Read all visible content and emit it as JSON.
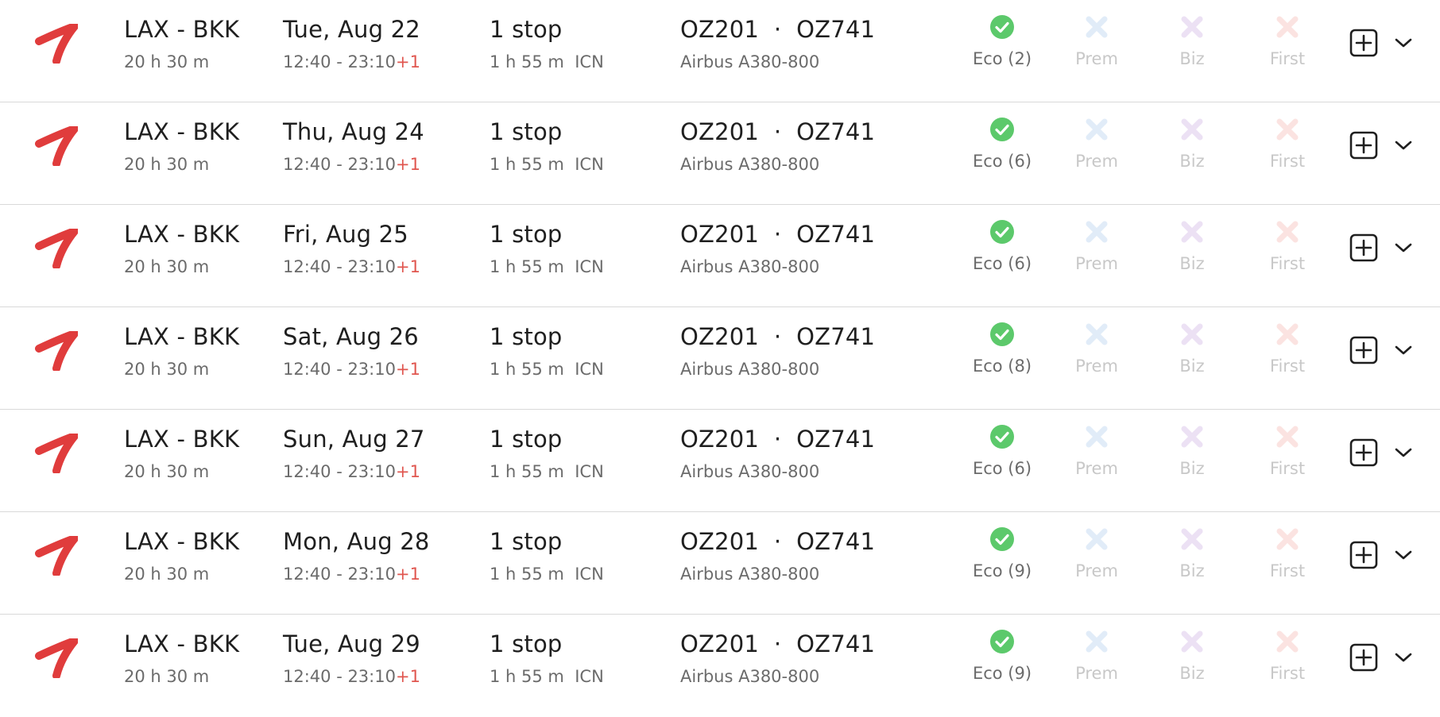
{
  "colors": {
    "logo": "#e03c3c",
    "available": "#5cc96b",
    "prem_unavailable": "#e1ecf8",
    "biz_unavailable": "#ece1f4",
    "first_unavailable": "#fbe3e1",
    "plus_one": "#e0564f"
  },
  "icons": {
    "airline_logo": "airline-logo-icon",
    "available": "check-circle-icon",
    "unavailable": "x-icon",
    "add": "plus-square-icon",
    "expand": "chevron-down-icon"
  },
  "flights": [
    {
      "route": "LAX - BKK",
      "duration": "20 h 30 m",
      "date": "Tue, Aug 22",
      "times": "12:40 - 23:10",
      "day_offset": "+1",
      "stops": "1 stop",
      "layover": "1 h 55 m  ICN",
      "flights": "OZ201  ·  OZ741",
      "aircraft": "Airbus A380-800",
      "cabins": {
        "eco": {
          "label": "Eco (2)",
          "available": true
        },
        "prem": {
          "label": "Prem",
          "available": false
        },
        "biz": {
          "label": "Biz",
          "available": false
        },
        "first": {
          "label": "First",
          "available": false
        }
      }
    },
    {
      "route": "LAX - BKK",
      "duration": "20 h 30 m",
      "date": "Thu, Aug 24",
      "times": "12:40 - 23:10",
      "day_offset": "+1",
      "stops": "1 stop",
      "layover": "1 h 55 m  ICN",
      "flights": "OZ201  ·  OZ741",
      "aircraft": "Airbus A380-800",
      "cabins": {
        "eco": {
          "label": "Eco (6)",
          "available": true
        },
        "prem": {
          "label": "Prem",
          "available": false
        },
        "biz": {
          "label": "Biz",
          "available": false
        },
        "first": {
          "label": "First",
          "available": false
        }
      }
    },
    {
      "route": "LAX - BKK",
      "duration": "20 h 30 m",
      "date": "Fri, Aug 25",
      "times": "12:40 - 23:10",
      "day_offset": "+1",
      "stops": "1 stop",
      "layover": "1 h 55 m  ICN",
      "flights": "OZ201  ·  OZ741",
      "aircraft": "Airbus A380-800",
      "cabins": {
        "eco": {
          "label": "Eco (6)",
          "available": true
        },
        "prem": {
          "label": "Prem",
          "available": false
        },
        "biz": {
          "label": "Biz",
          "available": false
        },
        "first": {
          "label": "First",
          "available": false
        }
      }
    },
    {
      "route": "LAX - BKK",
      "duration": "20 h 30 m",
      "date": "Sat, Aug 26",
      "times": "12:40 - 23:10",
      "day_offset": "+1",
      "stops": "1 stop",
      "layover": "1 h 55 m  ICN",
      "flights": "OZ201  ·  OZ741",
      "aircraft": "Airbus A380-800",
      "cabins": {
        "eco": {
          "label": "Eco (8)",
          "available": true
        },
        "prem": {
          "label": "Prem",
          "available": false
        },
        "biz": {
          "label": "Biz",
          "available": false
        },
        "first": {
          "label": "First",
          "available": false
        }
      }
    },
    {
      "route": "LAX - BKK",
      "duration": "20 h 30 m",
      "date": "Sun, Aug 27",
      "times": "12:40 - 23:10",
      "day_offset": "+1",
      "stops": "1 stop",
      "layover": "1 h 55 m  ICN",
      "flights": "OZ201  ·  OZ741",
      "aircraft": "Airbus A380-800",
      "cabins": {
        "eco": {
          "label": "Eco (6)",
          "available": true
        },
        "prem": {
          "label": "Prem",
          "available": false
        },
        "biz": {
          "label": "Biz",
          "available": false
        },
        "first": {
          "label": "First",
          "available": false
        }
      }
    },
    {
      "route": "LAX - BKK",
      "duration": "20 h 30 m",
      "date": "Mon, Aug 28",
      "times": "12:40 - 23:10",
      "day_offset": "+1",
      "stops": "1 stop",
      "layover": "1 h 55 m  ICN",
      "flights": "OZ201  ·  OZ741",
      "aircraft": "Airbus A380-800",
      "cabins": {
        "eco": {
          "label": "Eco (9)",
          "available": true
        },
        "prem": {
          "label": "Prem",
          "available": false
        },
        "biz": {
          "label": "Biz",
          "available": false
        },
        "first": {
          "label": "First",
          "available": false
        }
      }
    },
    {
      "route": "LAX - BKK",
      "duration": "20 h 30 m",
      "date": "Tue, Aug 29",
      "times": "12:40 - 23:10",
      "day_offset": "+1",
      "stops": "1 stop",
      "layover": "1 h 55 m  ICN",
      "flights": "OZ201  ·  OZ741",
      "aircraft": "Airbus A380-800",
      "cabins": {
        "eco": {
          "label": "Eco (9)",
          "available": true
        },
        "prem": {
          "label": "Prem",
          "available": false
        },
        "biz": {
          "label": "Biz",
          "available": false
        },
        "first": {
          "label": "First",
          "available": false
        }
      }
    }
  ]
}
